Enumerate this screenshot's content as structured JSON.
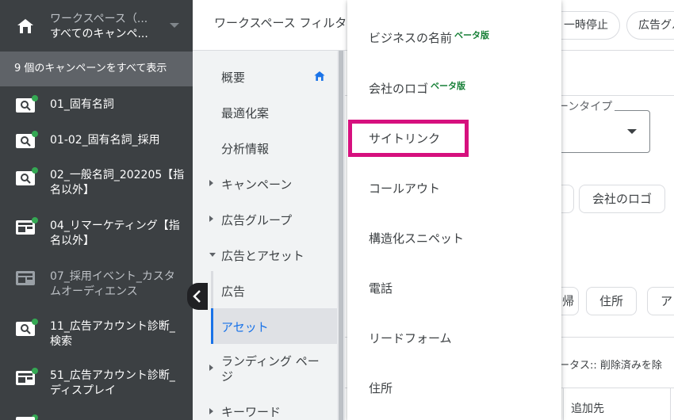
{
  "workspace": {
    "line1": "ワークスペース（...",
    "line2": "すべてのキャンペ..."
  },
  "sidebar": {
    "show_all": "9 個のキャンペーンをすべて表示",
    "campaigns": [
      {
        "name": "01_固有名詞",
        "icon": "search-campaign-icon"
      },
      {
        "name": "01-02_固有名詞_採用",
        "icon": "search-campaign-icon"
      },
      {
        "name": "02_一般名詞_202205【指名以外】",
        "icon": "search-campaign-icon"
      },
      {
        "name": "04_リマーケティング【指名以外】",
        "icon": "display-campaign-icon"
      },
      {
        "name": "07_採用イベント_カスタムオーディエンス",
        "icon": "display-campaign-icon"
      },
      {
        "name": "11_広告アカウント診断_検索",
        "icon": "search-campaign-icon"
      },
      {
        "name": "51_広告アカウント診断_ディスプレイ",
        "icon": "display-campaign-icon"
      }
    ]
  },
  "topbar": {
    "workspace_filter": "ワークスペース フィルタ",
    "pause_chip": "一時停止",
    "adgroup_chip": "広告グル"
  },
  "pagenav": {
    "overview": "概要",
    "recommendations": "最適化案",
    "insights": "分析情報",
    "campaigns": "キャンペーン",
    "adgroups": "広告グループ",
    "ads_assets": "広告とアセット",
    "ads": "広告",
    "assets": "アセット",
    "landing_pages": "ランディング ページ",
    "keywords": "キーワード"
  },
  "main": {
    "campaign_type_label": "ーンタイプ",
    "pill_logo": "会社のロゴ",
    "pill_partial": "帰",
    "pill_address": "住所",
    "pill_partial2": "ア",
    "status_filter": "ータス:: 削除済みを除",
    "col_added_to": "追加先"
  },
  "menu": {
    "items": [
      {
        "label": "ビジネスの名前",
        "badge": "ベータ版"
      },
      {
        "label": "会社のロゴ",
        "badge": "ベータ版"
      },
      {
        "label": "サイトリンク",
        "badge": ""
      },
      {
        "label": "コールアウト",
        "badge": ""
      },
      {
        "label": "構造化スニペット",
        "badge": ""
      },
      {
        "label": "電話",
        "badge": ""
      },
      {
        "label": "リードフォーム",
        "badge": ""
      },
      {
        "label": "住所",
        "badge": ""
      }
    ],
    "highlighted_item": "サイトリンク"
  },
  "colors": {
    "sidebar_dark": "#3c4043",
    "status_green": "#34a853",
    "accent_blue": "#1a73e8",
    "highlight_magenta": "#d6107e",
    "beta_green": "#188038"
  }
}
